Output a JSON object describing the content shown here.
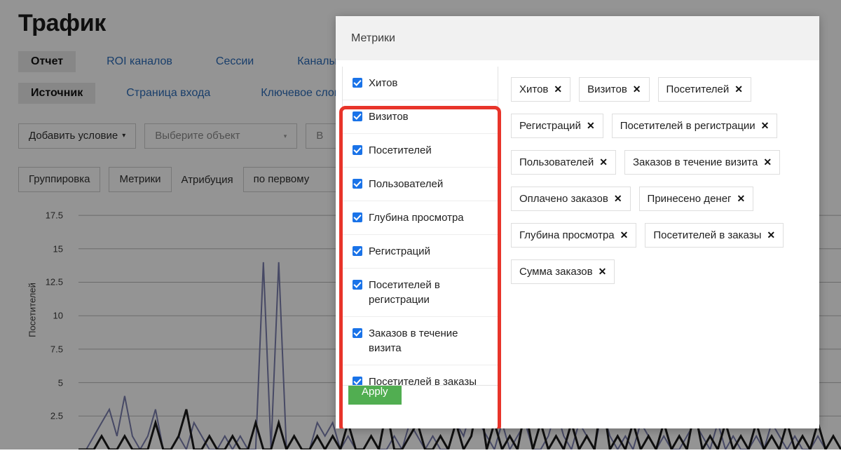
{
  "page": {
    "title": "Трафик",
    "tabs_primary": [
      {
        "label": "Отчет",
        "active": true
      },
      {
        "label": "ROI каналов",
        "active": false
      },
      {
        "label": "Сессии",
        "active": false
      },
      {
        "label": "Каналы",
        "active": false
      }
    ],
    "tabs_secondary": [
      {
        "label": "Источник",
        "active": true
      },
      {
        "label": "Страница входа",
        "active": false
      },
      {
        "label": "Ключевое слово",
        "active": false
      }
    ],
    "controls_row1": {
      "add_condition_label": "Добавить условие",
      "caret": "▾",
      "object_select_value": "Выберите объект",
      "select_caret": "▾",
      "third_control_value": "В"
    },
    "controls_row2": {
      "grouping_label": "Группировка",
      "metrics_label": "Метрики",
      "attribution_label": "Атрибуция",
      "attribution_value": "по первому",
      "wide_caret": "▾"
    }
  },
  "chart_data": {
    "type": "line",
    "title": "",
    "xlabel": "",
    "ylabel": "Посетителей",
    "ylim": [
      0,
      18.5
    ],
    "yticks": [
      17.5,
      15,
      12.5,
      10,
      7.5,
      5,
      2.5
    ],
    "ytick_labels": [
      "17.5",
      "15",
      "12.5",
      "10",
      "7.5",
      "5",
      "2.5"
    ],
    "grid": true,
    "legend": "none",
    "series": [
      {
        "name": "Посетителей",
        "color": "#7b7fae",
        "values": [
          0,
          0,
          1,
          2,
          3,
          1,
          4,
          1,
          0,
          1,
          3,
          0,
          0,
          1,
          0,
          2,
          1,
          0,
          0,
          1,
          0,
          1,
          0,
          0,
          14,
          0,
          14,
          0,
          1,
          0,
          0,
          2,
          1,
          2,
          0,
          1,
          0,
          0,
          1,
          0,
          0,
          1,
          0,
          2,
          1,
          0,
          1,
          0,
          0,
          2,
          1,
          3,
          2,
          1,
          0,
          2,
          0,
          1,
          2,
          0,
          0,
          1,
          3,
          1,
          0,
          2,
          1,
          0,
          3,
          1,
          0,
          1,
          0,
          2,
          1,
          0,
          1,
          0,
          0,
          1,
          2,
          1,
          0,
          2,
          0,
          1,
          0,
          0,
          1,
          0,
          2,
          1,
          0,
          1,
          0,
          0,
          1,
          0,
          1,
          0
        ]
      },
      {
        "name": "Хитов",
        "color": "#1a1a1a",
        "values": [
          0,
          0,
          0,
          1,
          0,
          0,
          1,
          0,
          0,
          0,
          2,
          0,
          0,
          1,
          3,
          0,
          0,
          1,
          0,
          0,
          1,
          0,
          0,
          2,
          0,
          0,
          2,
          0,
          1,
          0,
          0,
          1,
          0,
          1,
          0,
          2,
          0,
          0,
          1,
          0,
          3,
          0,
          0,
          1,
          2,
          0,
          0,
          1,
          0,
          2,
          0,
          1,
          4,
          0,
          2,
          0,
          1,
          0,
          3,
          0,
          2,
          0,
          1,
          0,
          2,
          0,
          1,
          0,
          4,
          0,
          1,
          0,
          2,
          0,
          1,
          0,
          2,
          0,
          1,
          0,
          3,
          0,
          1,
          0,
          2,
          0,
          1,
          0,
          2,
          0,
          1,
          0,
          2,
          0,
          1,
          0,
          2,
          0,
          1,
          0
        ]
      }
    ]
  },
  "modal": {
    "title": "Метрики",
    "metrics": [
      {
        "label": "Хитов",
        "checked": true
      },
      {
        "label": "Визитов",
        "checked": true
      },
      {
        "label": "Посетителей",
        "checked": true
      },
      {
        "label": "Пользователей",
        "checked": true
      },
      {
        "label": "Глубина просмотра",
        "checked": true
      },
      {
        "label": "Регистраций",
        "checked": true
      },
      {
        "label": "Посетителей в регистрации",
        "checked": true
      },
      {
        "label": "Заказов в течение визита",
        "checked": true
      },
      {
        "label": "Посетителей в заказы",
        "checked": true
      }
    ],
    "tags": [
      {
        "label": "Хитов",
        "remove": "✕"
      },
      {
        "label": "Визитов",
        "remove": "✕"
      },
      {
        "label": "Посетителей",
        "remove": "✕"
      },
      {
        "label": "Регистраций",
        "remove": "✕"
      },
      {
        "label": "Посетителей в регистрации",
        "remove": "✕"
      },
      {
        "label": "Пользователей",
        "remove": "✕"
      },
      {
        "label": "Заказов в течение визита",
        "remove": "✕"
      },
      {
        "label": "Оплачено заказов",
        "remove": "✕"
      },
      {
        "label": "Принесено денег",
        "remove": "✕"
      },
      {
        "label": "Глубина просмотра",
        "remove": "✕"
      },
      {
        "label": "Посетителей в заказы",
        "remove": "✕"
      },
      {
        "label": "Сумма заказов",
        "remove": "✕"
      }
    ],
    "apply_label": "Apply"
  },
  "colors": {
    "highlight": "#e8342a",
    "apply": "#51ae51",
    "checkbox": "#1a73e8",
    "link": "#2b6cb8"
  }
}
